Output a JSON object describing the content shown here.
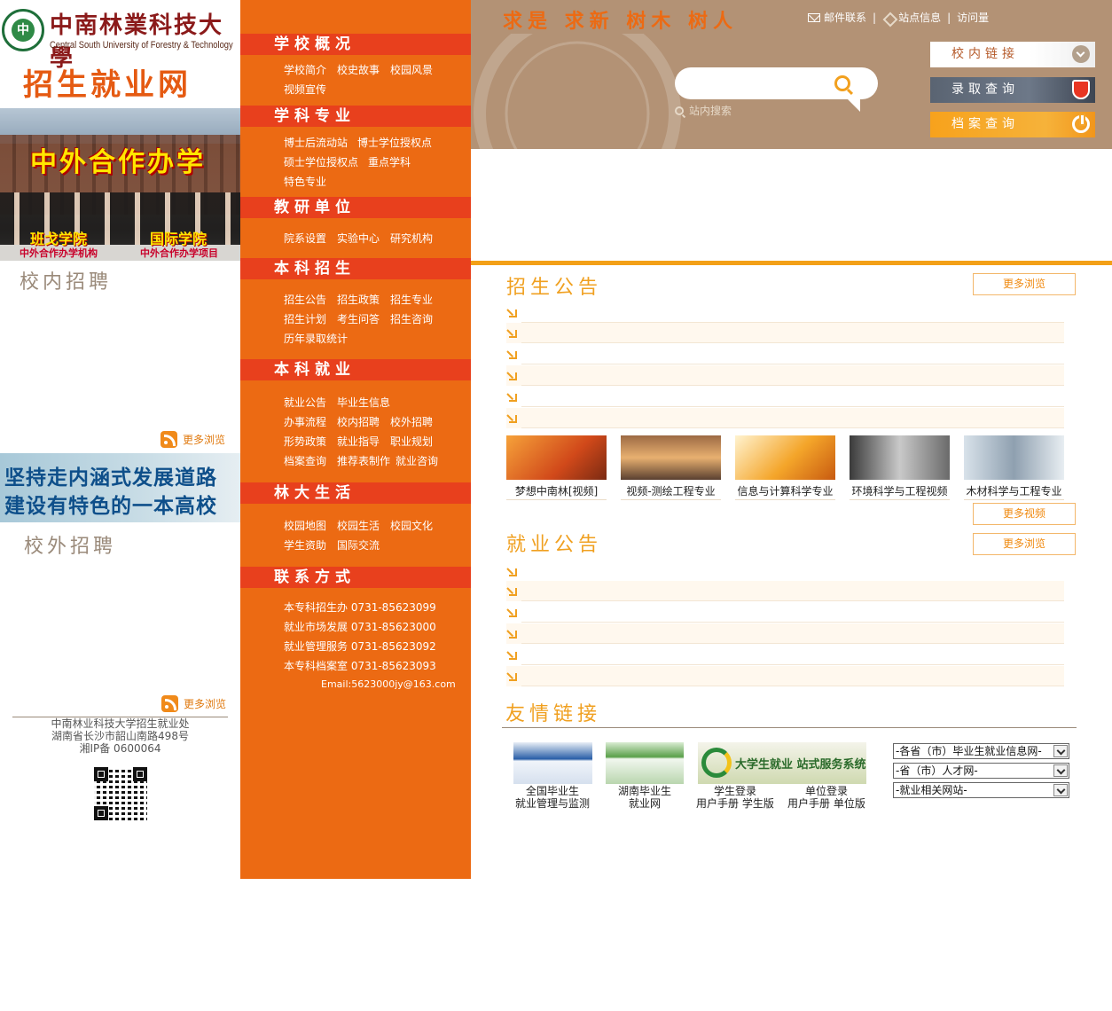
{
  "left": {
    "logo_cn": "中南林業科技大學",
    "logo_en": "Central South University of Forestry & Technology",
    "site_name": "招生就业网",
    "banner": {
      "title": "中外合作办学",
      "left_name": "班戈学院",
      "right_name": "国际学院",
      "left_sub": "中外合作办学机构",
      "right_sub": "中外合作办学项目"
    },
    "campus_recruit_title": "校内招聘",
    "campus_more": "更多浏览",
    "slogan_line1": "坚持走内涵式发展道路",
    "slogan_line2": "建设有特色的一本高校",
    "offcampus_recruit_title": "校外招聘",
    "offcampus_more": "更多浏览",
    "footer_line1": "中南林业科技大学招生就业处",
    "footer_line2": "湖南省长沙市韶山南路498号",
    "footer_line3": "湘IP备 0600064"
  },
  "nav": {
    "sections": [
      {
        "title": "学校概况",
        "links": [
          "学校简介",
          "校史故事",
          "校园风景",
          "视频宣传"
        ]
      },
      {
        "title": "学科专业",
        "links": [
          "博士后流动站",
          "博士学位授权点",
          "硕士学位授权点",
          "重点学科",
          "特色专业"
        ]
      },
      {
        "title": "教研单位",
        "links": [
          "院系设置",
          "实验中心",
          "研究机构"
        ]
      },
      {
        "title": "本科招生",
        "links": [
          "招生公告",
          "招生政策",
          "招生专业",
          "招生计划",
          "考生问答",
          "招生咨询",
          "历年录取统计"
        ]
      },
      {
        "title": "本科就业",
        "links": [
          "就业公告",
          "毕业生信息",
          "办事流程",
          "校内招聘",
          "校外招聘",
          "形势政策",
          "就业指导",
          "职业规划",
          "档案查询",
          "推荐表制作",
          "就业咨询"
        ]
      },
      {
        "title": "林大生活",
        "links": [
          "校园地图",
          "校园生活",
          "校园文化",
          "学生资助",
          "国际交流"
        ]
      },
      {
        "title": "联系方式",
        "links": [
          "本专科招生办 0731-85623099",
          "就业市场发展 0731-85623000",
          "就业管理服务 0731-85623092",
          "本专科档案室 0731-85623093",
          "Email:5623000jy@163.com"
        ]
      }
    ]
  },
  "header": {
    "motto": "求是 求新 树木 树人",
    "mail_link": "邮件联系",
    "sitemap_link": "站点信息",
    "visitor_link": "访问量",
    "search_placeholder": "",
    "search_label": "站内搜索",
    "btn_campus": "校内链接",
    "btn_admit": "录取查询",
    "btn_file": "档案查询",
    "colors": {
      "brand_orange": "#ec6a13",
      "header_tan": "#b39275",
      "accent": "#f3a017"
    }
  },
  "main": {
    "admission_title": "招生公告",
    "admission_more": "更多浏览",
    "videos": [
      {
        "caption": "梦想中南林[视频]"
      },
      {
        "caption": "视频-测绘工程专业"
      },
      {
        "caption": "信息与计算科学专业"
      },
      {
        "caption": "环境科学与工程视频"
      },
      {
        "caption": "木材科学与工程专业"
      }
    ],
    "videos_more": "更多视频",
    "employment_title": "就业公告",
    "employment_more": "更多浏览",
    "friend_title": "友情链接",
    "friend_links": {
      "link1_line1": "全国毕业生",
      "link1_line2": "就业管理与监测",
      "link2_line1": "湖南毕业生",
      "link2_line2": "就业网",
      "link3_img_text": "大学生就业 站式服务系统",
      "student_login": "学生登录",
      "unit_login": "单位登录",
      "student_manual": "用户手册 学生版",
      "unit_manual": "用户手册 单位版"
    },
    "selects": [
      "-各省（市）毕业生就业信息网-",
      "-省（市）人才网-",
      "-就业相关网站-"
    ]
  }
}
